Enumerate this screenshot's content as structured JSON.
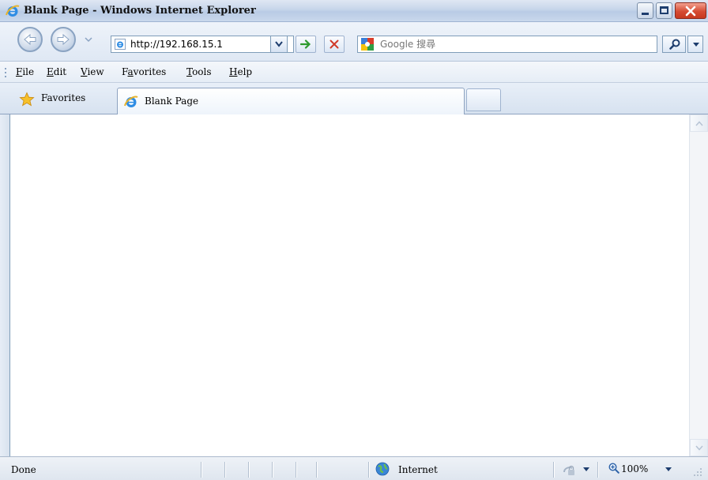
{
  "window": {
    "title": "Blank Page - Windows Internet Explorer"
  },
  "address_bar": {
    "url": "http://192.168.15.1"
  },
  "search": {
    "placeholder": "Google 搜尋"
  },
  "menu": {
    "items": [
      {
        "label": "File",
        "access_key": "F"
      },
      {
        "label": "Edit",
        "access_key": "E"
      },
      {
        "label": "View",
        "access_key": "V"
      },
      {
        "label": "Favorites",
        "access_key": "a"
      },
      {
        "label": "Tools",
        "access_key": "T"
      },
      {
        "label": "Help",
        "access_key": "H"
      }
    ]
  },
  "favorites": {
    "label": "Favorites"
  },
  "tabs": [
    {
      "label": "Blank Page",
      "active": true
    }
  ],
  "status": {
    "text": "Done",
    "zone": "Internet",
    "zoom": "100%"
  },
  "colors": {
    "accent": "#7f9db9",
    "close_button": "#d54b33",
    "go_arrow": "#2e9a2e",
    "stop_x": "#d03a2a"
  },
  "icons": {
    "title": "ie-logo-icon",
    "back": "back-arrow-icon",
    "forward": "forward-arrow-icon",
    "address": "ie-page-icon",
    "go": "go-arrow-icon",
    "stop": "stop-x-icon",
    "search_provider": "google-icon",
    "search": "magnifier-icon",
    "favorites": "star-icon",
    "tab": "ie-logo-icon",
    "zone": "globe-icon",
    "protected_mode": "lock-icon",
    "zoom": "zoom-icon"
  }
}
